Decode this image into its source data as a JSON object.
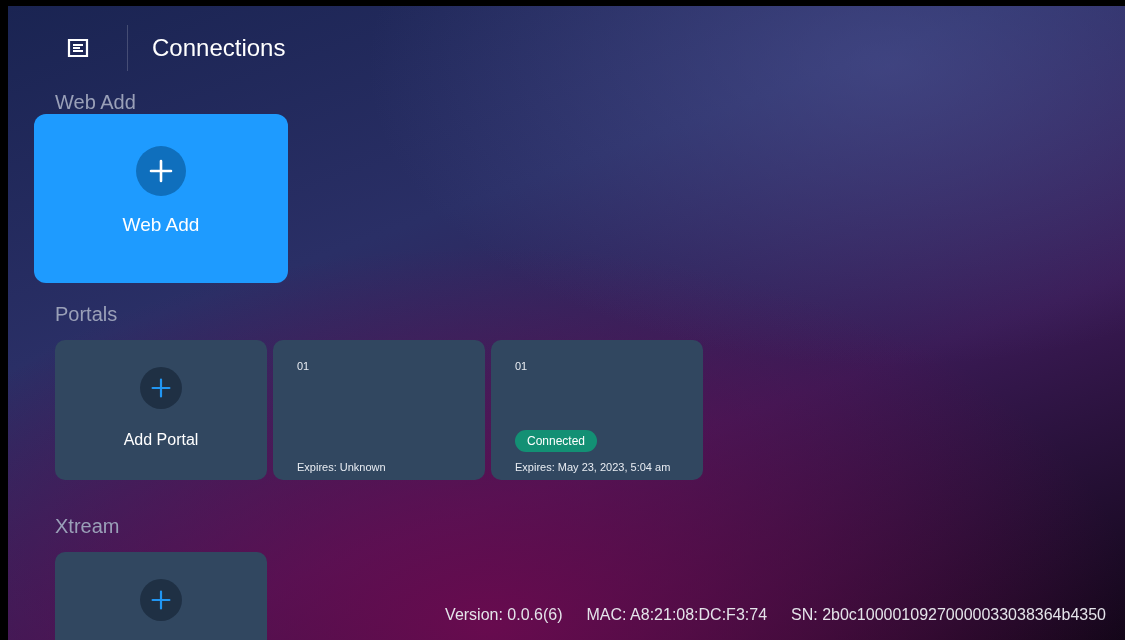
{
  "header": {
    "title": "Connections"
  },
  "sections": [
    {
      "title": "Web Add",
      "cards": [
        {
          "kind": "add",
          "label": "Web Add",
          "focused": true
        }
      ]
    },
    {
      "title": "Portals",
      "cards": [
        {
          "kind": "add",
          "label": "Add Portal",
          "focused": false
        },
        {
          "kind": "portal",
          "name": "01",
          "expires": "Expires: Unknown",
          "focused": false
        },
        {
          "kind": "portal",
          "name": "01",
          "status": "Connected",
          "expires": "Expires: May 23, 2023, 5:04 am",
          "focused": false
        }
      ]
    },
    {
      "title": "Xtream",
      "cards": [
        {
          "kind": "add",
          "focused": false
        }
      ]
    }
  ],
  "footer": {
    "version": "Version: 0.0.6(6)",
    "mac": "MAC: A8:21:08:DC:F3:74",
    "sn": "SN: 2b0c10000109270000033038364b4350"
  }
}
